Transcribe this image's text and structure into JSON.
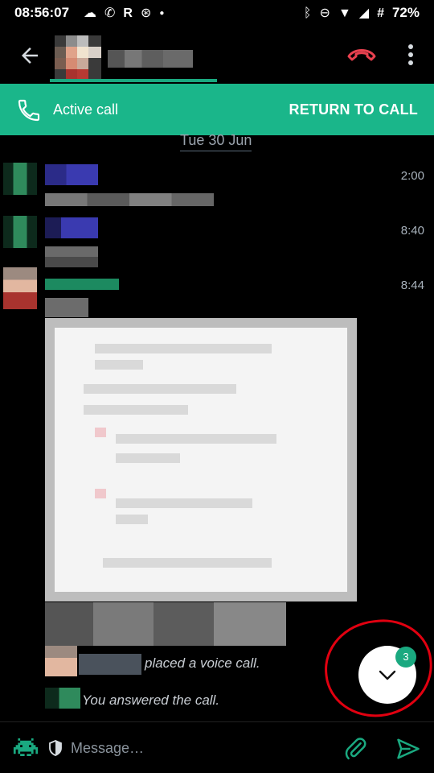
{
  "status_bar": {
    "time": "08:56:07",
    "battery": "72%",
    "left_icons": [
      "cloud-icon",
      "phone-icon",
      "r-app-icon",
      "steering-icon",
      "dot-icon"
    ],
    "right_icons": [
      "bluetooth-icon",
      "dnd-icon",
      "wifi-icon",
      "signal-icon",
      "hash-icon"
    ]
  },
  "top_bar": {
    "back_icon": "arrow-left-icon",
    "hangup_icon": "hangup-icon",
    "overflow_icon": "more-vert-icon",
    "accent_color": "#1aa980",
    "hangup_color": "#e8414f"
  },
  "call_banner": {
    "label": "Active call",
    "action": "RETURN TO CALL",
    "background": "#1ab68a"
  },
  "timeline": {
    "date_separator": "Tue 30 Jun",
    "messages": [
      {
        "timestamp": "2:00"
      },
      {
        "timestamp": "8:40"
      },
      {
        "timestamp": "8:44"
      }
    ],
    "events": [
      {
        "text": "placed a voice call."
      },
      {
        "text": "You answered the call."
      }
    ]
  },
  "scroll_fab": {
    "badge_count": "3",
    "icon": "chevron-down-icon"
  },
  "composer": {
    "placeholder": "Message…",
    "value": "",
    "icons": [
      "invader-icon",
      "shield-icon",
      "paperclip-icon",
      "send-icon"
    ]
  }
}
